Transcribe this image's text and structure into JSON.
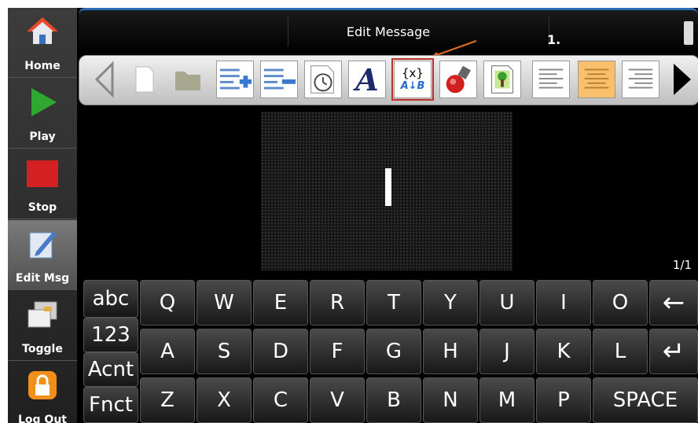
{
  "sidebar": {
    "items": [
      {
        "label": "Home",
        "icon": "home-icon"
      },
      {
        "label": "Play",
        "icon": "play-icon"
      },
      {
        "label": "Stop",
        "icon": "stop-icon"
      },
      {
        "label": "Edit Msg",
        "icon": "edit-pencil-icon",
        "active": true
      },
      {
        "label": "Toggle",
        "icon": "toggle-icon"
      },
      {
        "label": "Log Out",
        "icon": "lock-icon"
      }
    ]
  },
  "titlebar": {
    "title": "Edit Message",
    "annotation": "1."
  },
  "toolbar": {
    "icons": [
      "arrow-left-icon",
      "new-document-icon",
      "folder-icon",
      "add-line-icon",
      "remove-line-icon",
      "clock-icon",
      "font-icon",
      "variable-field-icon",
      "barcode-sensor-icon",
      "image-icon",
      "align-left-icon",
      "align-center-icon",
      "align-right-icon",
      "arrow-right-icon"
    ],
    "variable_icon_text": "{x}",
    "variable_icon_sub": "A↓B",
    "font_glyph": "A"
  },
  "page_indicator": "1/1",
  "keyboard": {
    "modes": [
      "abc",
      "123",
      "Acnt",
      "Fnct"
    ],
    "row1": [
      "Q",
      "W",
      "E",
      "R",
      "T",
      "Y",
      "U",
      "I",
      "O"
    ],
    "row2": [
      "A",
      "S",
      "D",
      "F",
      "G",
      "H",
      "J",
      "K",
      "L"
    ],
    "row3": [
      "Z",
      "X",
      "C",
      "V",
      "B",
      "N",
      "M",
      "P"
    ],
    "backspace": "←",
    "enter": "↵",
    "space": "SPACE"
  },
  "colors": {
    "accent_blue": "#2b6db8",
    "highlight_red": "#c0302a",
    "annotation_orange": "#e07020",
    "play_green": "#2ea82e",
    "stop_red": "#d42020",
    "lock_orange": "#f0901a",
    "align_highlight": "#f8c06a"
  }
}
